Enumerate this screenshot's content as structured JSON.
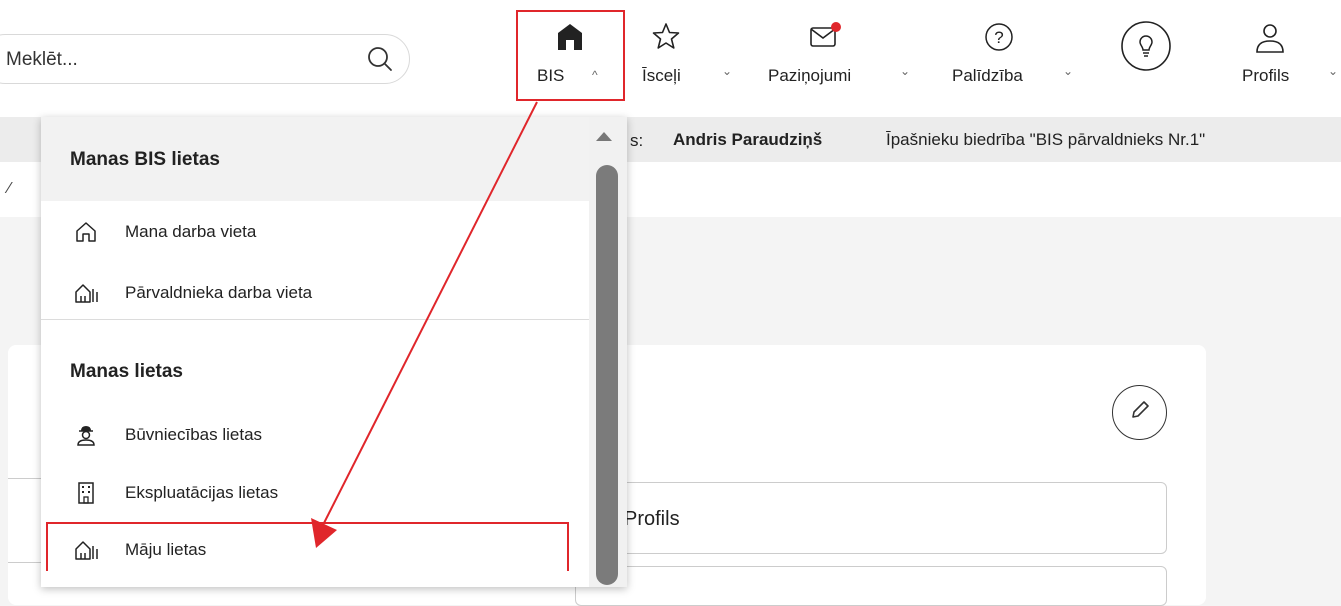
{
  "search": {
    "placeholder": "Meklēt..."
  },
  "nav": {
    "bis": {
      "label": "BIS",
      "chevron": "^"
    },
    "favorites": {
      "label": "Īsceļi",
      "chevron": "⌄"
    },
    "notifications": {
      "label": "Paziņojumi",
      "chevron": "⌄"
    },
    "help": {
      "label": "Palīdzība",
      "chevron": "⌄"
    },
    "profile": {
      "label": "Profils",
      "chevron": "⌄"
    }
  },
  "infobar": {
    "separator": "s:",
    "user": "Andris Paraudziņš",
    "org": "Īpašnieku biedrība \"BIS pārvaldnieks Nr.1\""
  },
  "breadcrumb_mark": "⁄",
  "dropdown": {
    "header": "Manas BIS lietas",
    "top_items": [
      {
        "label": "Mana darba vieta",
        "icon": "house-icon"
      },
      {
        "label": "Pārvaldnieka darba vieta",
        "icon": "houses-icon"
      }
    ],
    "section": "Manas lietas",
    "items": [
      {
        "label": "Būvniecības lietas",
        "icon": "worker-icon"
      },
      {
        "label": "Ekspluatācijas lietas",
        "icon": "building-icon"
      },
      {
        "label": "Māju lietas",
        "icon": "houses-icon"
      }
    ]
  },
  "form": {
    "field_value": "Profils"
  },
  "colors": {
    "highlight": "#e0262b",
    "notification_dot": "#e0262b",
    "dropdown_header_bg": "#f2f2f2"
  }
}
